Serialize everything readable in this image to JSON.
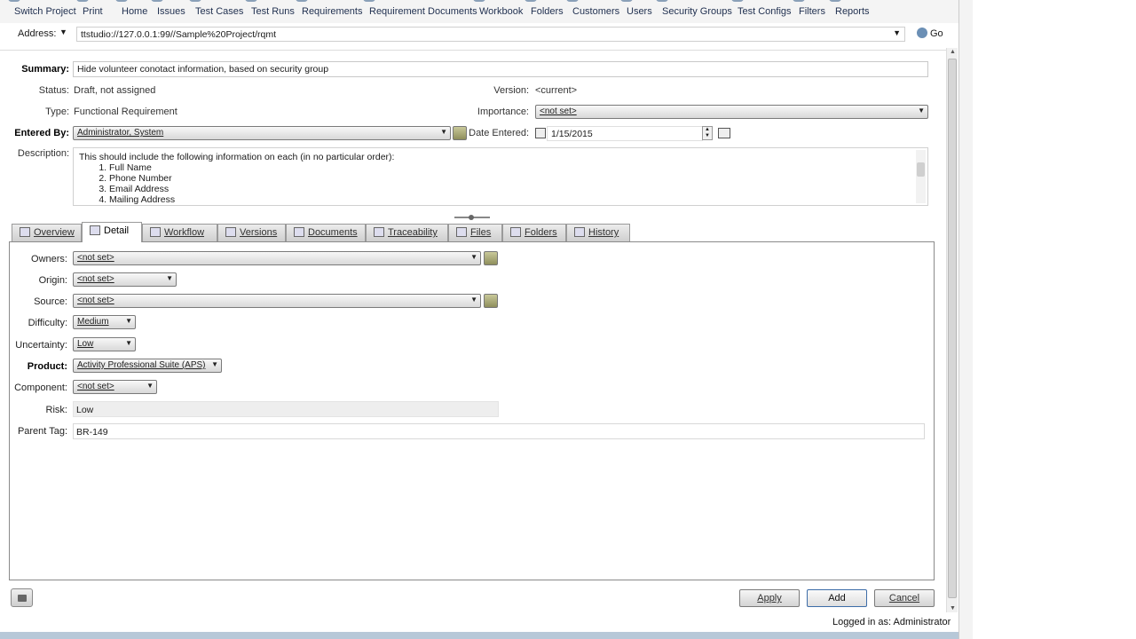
{
  "toolbar": [
    {
      "label": "Switch Project",
      "name": "switch-project"
    },
    {
      "label": "Print",
      "name": "print"
    },
    {
      "label": "Home",
      "name": "home"
    },
    {
      "label": "Issues",
      "name": "issues"
    },
    {
      "label": "Test Cases",
      "name": "test-cases"
    },
    {
      "label": "Test Runs",
      "name": "test-runs"
    },
    {
      "label": "Requirements",
      "name": "requirements"
    },
    {
      "label": "Requirement Documents",
      "name": "requirement-documents"
    },
    {
      "label": "Workbook",
      "name": "workbook"
    },
    {
      "label": "Folders",
      "name": "folders"
    },
    {
      "label": "Customers",
      "name": "customers"
    },
    {
      "label": "Users",
      "name": "users"
    },
    {
      "label": "Security Groups",
      "name": "security-groups"
    },
    {
      "label": "Test Configs",
      "name": "test-configs"
    },
    {
      "label": "Filters",
      "name": "filters"
    },
    {
      "label": "Reports",
      "name": "reports"
    }
  ],
  "address": {
    "label": "Address:",
    "value": "ttstudio://127.0.0.1:99//Sample%20Project/rqmt",
    "go_label": "Go"
  },
  "header": {
    "summary_label": "Summary:",
    "summary_value": "Hide volunteer conotact information, based on security group",
    "status_label": "Status:",
    "status_value": "Draft, not assigned",
    "version_label": "Version:",
    "version_value": "<current>",
    "type_label": "Type:",
    "type_value": "Functional Requirement",
    "importance_label": "Importance:",
    "importance_value": "<not set>",
    "entered_by_label": "Entered By:",
    "entered_by_value": "Administrator, System",
    "date_entered_label": "Date Entered:",
    "date_entered_value": "1/15/2015",
    "description_label": "Description:",
    "description_intro": "This should include the following information on each (in no particular order):",
    "description_items": [
      "Full Name",
      "Phone Number",
      "Email Address",
      "Mailing Address"
    ]
  },
  "tabs": [
    {
      "label": "Overview",
      "active": false
    },
    {
      "label": "Detail",
      "active": true
    },
    {
      "label": "Workflow",
      "active": false
    },
    {
      "label": "Versions",
      "active": false
    },
    {
      "label": "Documents",
      "active": false
    },
    {
      "label": "Traceability",
      "active": false
    },
    {
      "label": "Files",
      "active": false
    },
    {
      "label": "Folders",
      "active": false
    },
    {
      "label": "History",
      "active": false
    }
  ],
  "detail": {
    "owners_label": "Owners:",
    "owners_value": "<not set>",
    "origin_label": "Origin:",
    "origin_value": "<not set>",
    "source_label": "Source:",
    "source_value": "<not set>",
    "difficulty_label": "Difficulty:",
    "difficulty_value": "Medium",
    "uncertainty_label": "Uncertainty:",
    "uncertainty_value": "Low",
    "product_label": "Product:",
    "product_value": "Activity Professional Suite (APS)",
    "component_label": "Component:",
    "component_value": "<not set>",
    "risk_label": "Risk:",
    "risk_value": "Low",
    "parent_tag_label": "Parent Tag:",
    "parent_tag_value": "BR-149"
  },
  "buttons": {
    "apply": "Apply",
    "add": "Add",
    "cancel": "Cancel"
  },
  "status": "Logged in as: Administrator"
}
